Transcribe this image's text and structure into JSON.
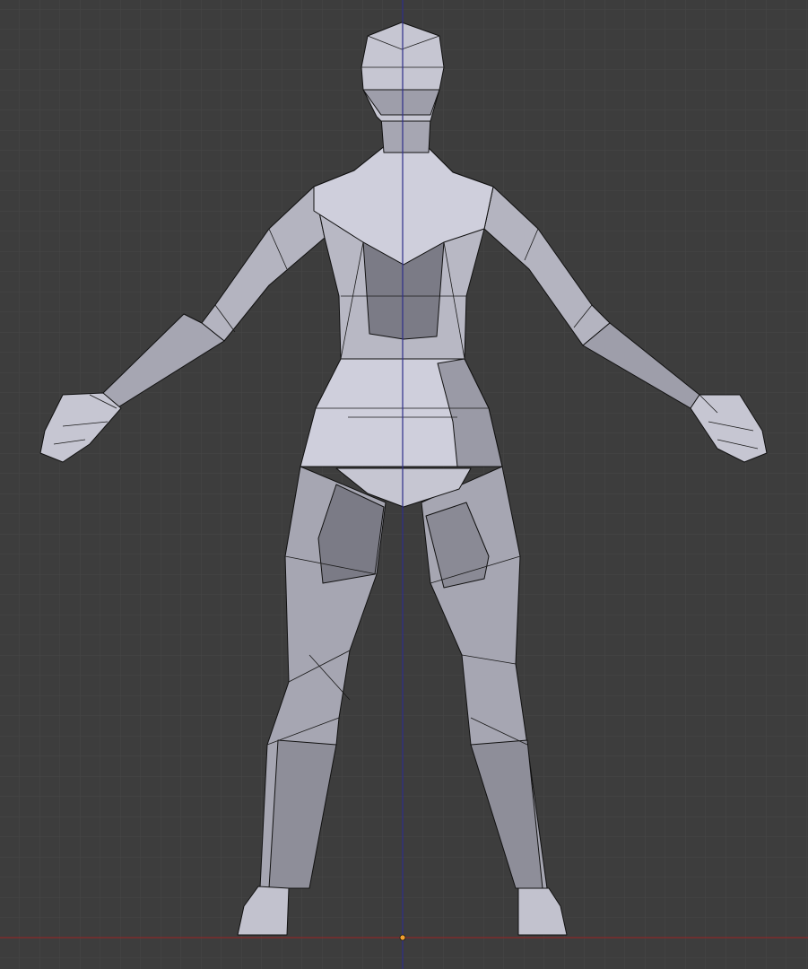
{
  "viewport": {
    "view": "back-orthographic",
    "colors": {
      "background": "#3d3d3d",
      "grid": "#474747",
      "axis_x": "#8a2a2a",
      "axis_z": "#2e2e8a",
      "origin": "#f0a030",
      "mesh_light": "#cfcfdc",
      "mesh_mid": "#a6a6b2",
      "mesh_dark": "#7b7b86"
    }
  }
}
